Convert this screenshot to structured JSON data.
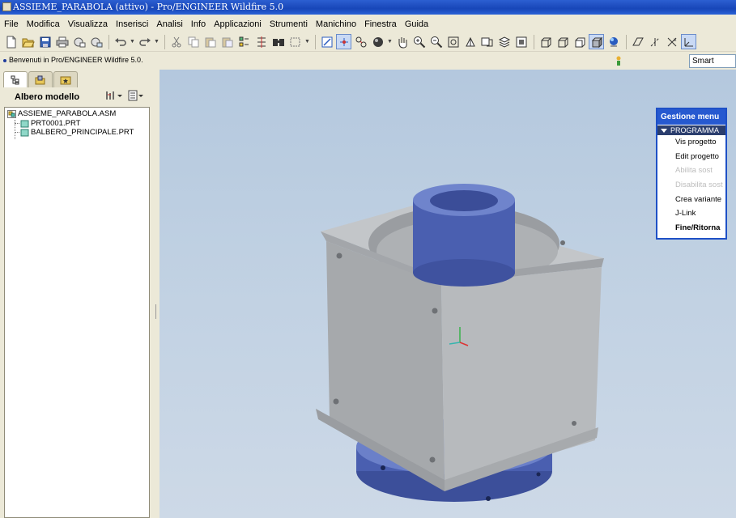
{
  "window": {
    "title": "ASSIEME_PARABOLA (attivo) - Pro/ENGINEER Wildfire 5.0"
  },
  "menubar": {
    "items": [
      "File",
      "Modifica",
      "Visualizza",
      "Inserisci",
      "Analisi",
      "Info",
      "Applicazioni",
      "Strumenti",
      "Manichino",
      "Finestra",
      "Guida"
    ]
  },
  "toolbar": {
    "icons": [
      "new-file-icon",
      "open-folder-icon",
      "save-icon",
      "print-icon",
      "send-mail-icon",
      "mail-attach-icon",
      "undo-icon",
      "redo-icon",
      "cut-icon",
      "copy-icon",
      "paste-icon",
      "paste-special-icon",
      "regenerate-icon",
      "regenerate-manager-icon",
      "find-icon",
      "select-box-icon",
      "repaint-icon",
      "spin-center-icon",
      "orient-mode-icon",
      "appearance-sphere-icon",
      "pan-hand-icon",
      "zoom-in-icon",
      "zoom-out-icon",
      "refit-icon",
      "reorient-icon",
      "saved-views-icon",
      "layers-icon",
      "view-manager-icon",
      "wireframe-icon",
      "hidden-line-icon",
      "no-hidden-icon",
      "shading-icon",
      "enhanced-realism-icon",
      "datum-planes-icon",
      "datum-axes-icon",
      "datum-points-icon",
      "coord-systems-icon"
    ]
  },
  "message_area": {
    "text": "Benvenuti in Pro/ENGINEER Wildfire 5.0.",
    "filter_value": "Smart"
  },
  "navigator": {
    "title": "Albero modello",
    "tree": [
      {
        "label": "ASSIEME_PARABOLA.ASM",
        "type": "assembly"
      },
      {
        "label": "PRT0001.PRT",
        "type": "part"
      },
      {
        "label": "BALBERO_PRINCIPALE.PRT",
        "type": "part"
      }
    ]
  },
  "menu_manager": {
    "title": "Gestione menu",
    "section": "PROGRAMMA",
    "items": [
      {
        "label": "Vis progetto",
        "enabled": true
      },
      {
        "label": "Edit progetto",
        "enabled": true
      },
      {
        "label": "Abilita sost",
        "enabled": false
      },
      {
        "label": "Disabilita sost",
        "enabled": false
      },
      {
        "label": "Crea variante",
        "enabled": true
      },
      {
        "label": "J-Link",
        "enabled": true
      },
      {
        "label": "Fine/Ritorna",
        "enabled": true,
        "bold": true
      }
    ]
  },
  "colors": {
    "title_bar": "#1846b8",
    "viewport_bg": "#bfd0e2",
    "model_grey": "#b3b6b9",
    "model_blue": "#4a5fb0",
    "menu_manager_header": "#2659d0"
  }
}
